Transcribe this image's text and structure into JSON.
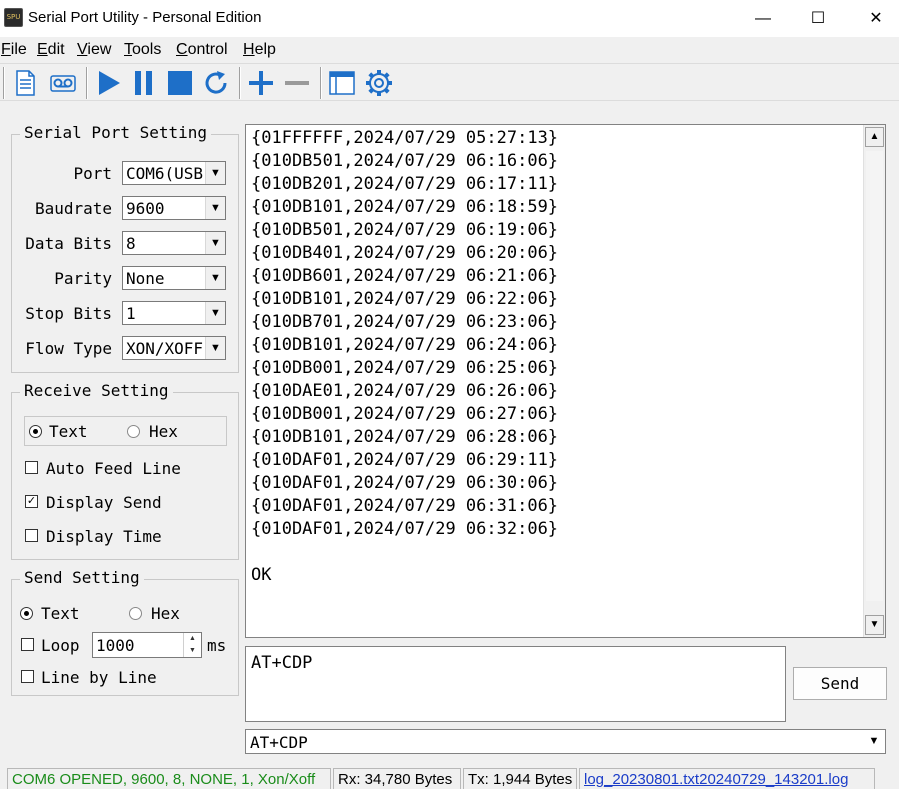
{
  "window": {
    "icon_text": "SPU",
    "title": "Serial Port Utility - Personal Edition",
    "minimize": "—",
    "maximize": "☐",
    "close": "✕"
  },
  "menu": {
    "items": [
      {
        "letter": "F",
        "rest": "ile"
      },
      {
        "letter": "E",
        "rest": "dit"
      },
      {
        "letter": "V",
        "rest": "iew"
      },
      {
        "letter": "T",
        "rest": "ools"
      },
      {
        "letter": "C",
        "rest": "ontrol"
      },
      {
        "letter": "H",
        "rest": "elp"
      }
    ]
  },
  "toolbar": {
    "icons": [
      "document-icon",
      "record-icon",
      "play-icon",
      "pause-icon",
      "stop-icon",
      "refresh-icon",
      "add-icon",
      "remove-icon",
      "window-icon",
      "gear-icon"
    ],
    "accent": "#1e6fc8"
  },
  "serial_port_setting": {
    "title": "Serial Port Setting",
    "fields": [
      {
        "label": "Port",
        "value": "COM6(USB"
      },
      {
        "label": "Baudrate",
        "value": "9600"
      },
      {
        "label": "Data Bits",
        "value": "8"
      },
      {
        "label": "Parity",
        "value": "None"
      },
      {
        "label": "Stop Bits",
        "value": "1"
      },
      {
        "label": "Flow Type",
        "value": "XON/XOFF"
      }
    ]
  },
  "receive_setting": {
    "title": "Receive Setting",
    "text_label": "Text",
    "hex_label": "Hex",
    "mode": "Text",
    "auto_feed_line": "Auto Feed Line",
    "display_send": "Display Send",
    "display_time": "Display Time",
    "auto_feed_line_checked": false,
    "display_send_checked": true,
    "display_time_checked": false
  },
  "send_setting": {
    "title": "Send Setting",
    "text_label": "Text",
    "hex_label": "Hex",
    "mode": "Text",
    "loop_label": "Loop",
    "loop_value": "1000",
    "loop_unit": "ms",
    "line_by_line": "Line by Line",
    "loop_checked": false,
    "line_by_line_checked": false
  },
  "receive_lines": [
    "{01FFFFFF,2024/07/29 05:27:13}",
    "{010DB501,2024/07/29 06:16:06}",
    "{010DB201,2024/07/29 06:17:11}",
    "{010DB101,2024/07/29 06:18:59}",
    "{010DB501,2024/07/29 06:19:06}",
    "{010DB401,2024/07/29 06:20:06}",
    "{010DB601,2024/07/29 06:21:06}",
    "{010DB101,2024/07/29 06:22:06}",
    "{010DB701,2024/07/29 06:23:06}",
    "{010DB101,2024/07/29 06:24:06}",
    "{010DB001,2024/07/29 06:25:06}",
    "{010DAE01,2024/07/29 06:26:06}",
    "{010DB001,2024/07/29 06:27:06}",
    "{010DB101,2024/07/29 06:28:06}",
    "{010DAF01,2024/07/29 06:29:11}",
    "{010DAF01,2024/07/29 06:30:06}",
    "{010DAF01,2024/07/29 06:31:06}",
    "{010DAF01,2024/07/29 06:32:06}",
    "",
    "OK"
  ],
  "send": {
    "text": "AT+CDP",
    "button_label": "Send",
    "history_value": "AT+CDP"
  },
  "status": {
    "connection": "COM6 OPENED, 9600, 8, NONE, 1, Xon/Xoff",
    "rx": "Rx: 34,780 Bytes",
    "tx": "Tx: 1,944 Bytes",
    "log_file": "log_20230801.txt20240729_143201.log",
    "connection_color": "#1a8c1a",
    "link_color": "#1a3cc8"
  }
}
